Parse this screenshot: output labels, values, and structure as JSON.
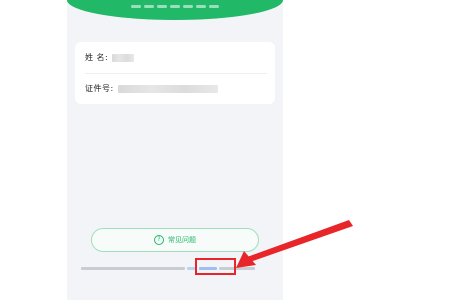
{
  "form": {
    "name_label": "姓    名:",
    "id_label": "证件号:"
  },
  "faq_button": {
    "icon": "question-icon",
    "label": "常见问题"
  },
  "annotation": {
    "highlight_color": "#e8262a"
  },
  "colors": {
    "brand_green": "#21b868",
    "link_blue": "#2f7ef0",
    "annotation_red": "#e8262a"
  }
}
